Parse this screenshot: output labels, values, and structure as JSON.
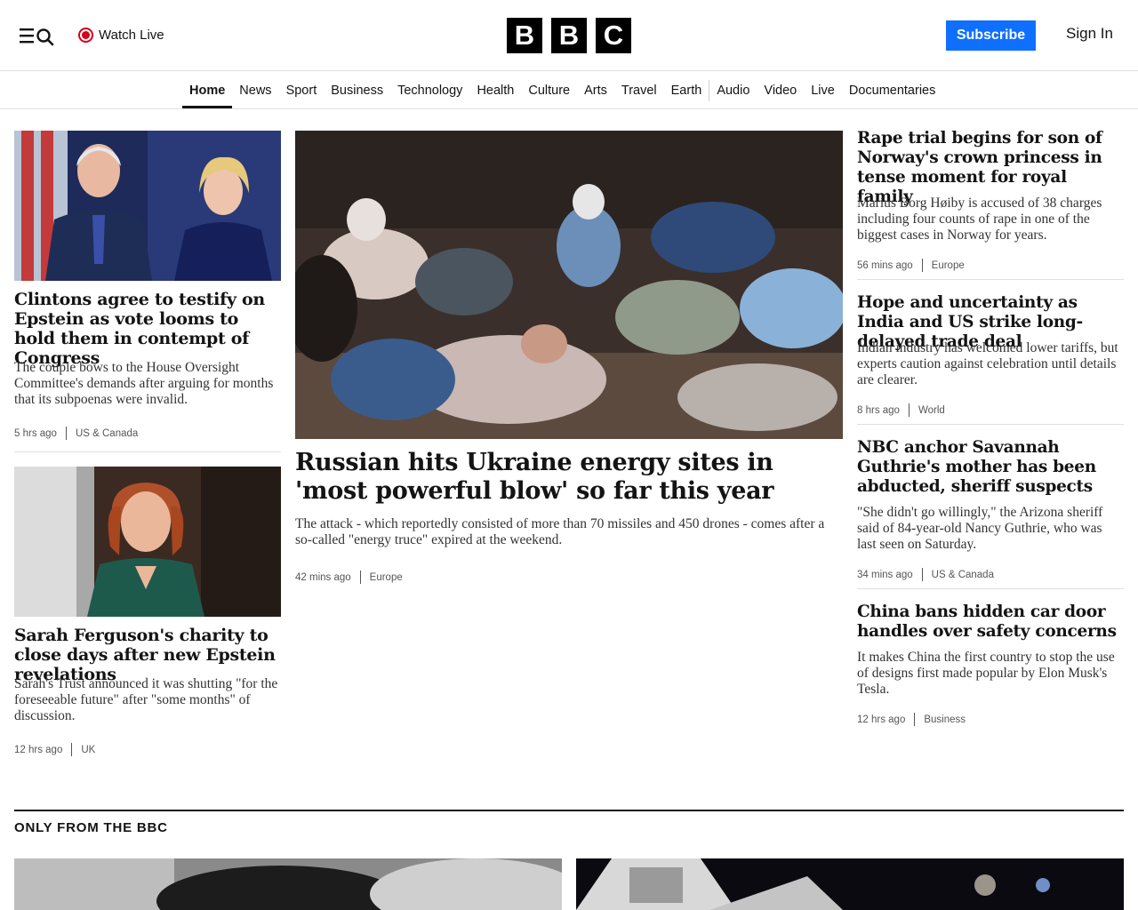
{
  "header": {
    "watch_live": "Watch Live",
    "logo_letters": [
      "B",
      "B",
      "C"
    ],
    "subscribe": "Subscribe",
    "sign_in": "Sign In"
  },
  "nav": {
    "items": [
      "Home",
      "News",
      "Sport",
      "Business",
      "Technology",
      "Health",
      "Culture",
      "Arts",
      "Travel",
      "Earth",
      "Audio",
      "Video",
      "Live",
      "Documentaries"
    ],
    "active": "Home"
  },
  "left_stories": [
    {
      "headline": "Clintons agree to testify on Epstein as vote looms to hold them in contempt of Congress",
      "summary": "The couple bows to the House Oversight Committee's demands after arguing for months that its subpoenas were invalid.",
      "time": "5 hrs ago",
      "category": "US & Canada"
    },
    {
      "headline": "Sarah Ferguson's charity to close days after new Epstein revelations",
      "summary": "Sarah's Trust announced it was shutting \"for the foreseeable future\" after \"some months\" of discussion.",
      "time": "12 hrs ago",
      "category": "UK"
    }
  ],
  "main_story": {
    "headline": "Russian hits Ukraine energy sites in 'most powerful blow' so far this year",
    "summary": "The attack - which reportedly consisted of more than 70 missiles and 450 drones - comes after a so-called \"energy truce\" expired at the weekend.",
    "time": "42 mins ago",
    "category": "Europe"
  },
  "right_stories": [
    {
      "headline": "Rape trial begins for son of Norway's crown princess in tense moment for royal family",
      "summary": "Marius Borg Høiby is accused of 38 charges including four counts of rape in one of the biggest cases in Norway for years.",
      "time": "56 mins ago",
      "category": "Europe"
    },
    {
      "headline": "Hope and uncertainty as India and US strike long-delayed trade deal",
      "summary": "Indian industry has welcomed lower tariffs, but experts caution against celebration until details are clearer.",
      "time": "8 hrs ago",
      "category": "World"
    },
    {
      "headline": "NBC anchor Savannah Guthrie's mother has been abducted, sheriff suspects",
      "summary": "\"She didn't go willingly,\" the Arizona sheriff said of 84-year-old Nancy Guthrie, who was last seen on Saturday.",
      "time": "34 mins ago",
      "category": "US & Canada"
    },
    {
      "headline": "China bans hidden car door handles over safety concerns",
      "summary": "It makes China the first country to stop the use of designs first made popular by Elon Musk's Tesla.",
      "time": "12 hrs ago",
      "category": "Business"
    }
  ],
  "section": {
    "title": "ONLY FROM THE BBC"
  },
  "colors": {
    "accent_blue": "#0f6fff",
    "live_red": "#d4001a",
    "text": "#141414"
  }
}
